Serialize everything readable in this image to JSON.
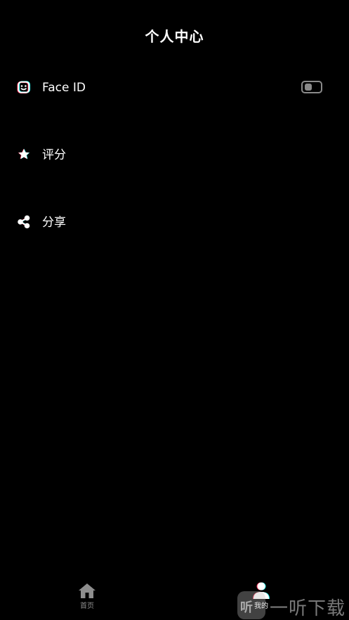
{
  "header": {
    "title": "个人中心"
  },
  "menu": {
    "items": [
      {
        "label": "Face ID",
        "icon": "face-id-icon",
        "toggle_on": false
      },
      {
        "label": "评分",
        "icon": "star-icon"
      },
      {
        "label": "分享",
        "icon": "share-icon"
      }
    ]
  },
  "tabbar": {
    "tabs": [
      {
        "label": "首页",
        "icon": "home-icon",
        "active": false
      },
      {
        "label": "我的",
        "icon": "person-icon",
        "active": true
      }
    ]
  },
  "watermark": {
    "logo_text": "听",
    "text": "一听下载"
  },
  "colors": {
    "background": "#000000",
    "text": "#ffffff",
    "inactive_tab": "#8e8e8e",
    "toggle_off": "#8a8a8a",
    "accent_cyan": "#25f4ee",
    "accent_red": "#fe2c55"
  }
}
